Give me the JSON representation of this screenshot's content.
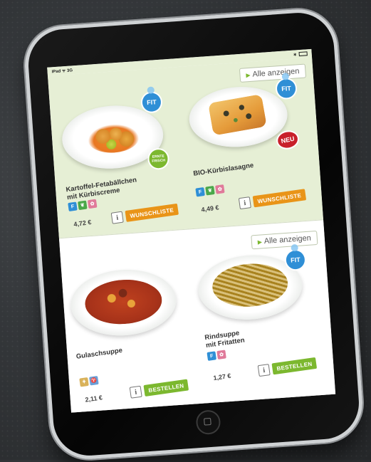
{
  "status_bar": {
    "left": "iPad ᯤ 3G",
    "right": "∗"
  },
  "sections": [
    {
      "show_all_label": "Alle anzeigen",
      "products": [
        {
          "name_line1": "Kartoffel-Fetabällchen",
          "name_line2": "mit Kürbiscreme",
          "price": "4,72 €",
          "badge_fit": "FIT",
          "badge_extra": "ERNTE FRISCH",
          "button_label": "WUNSCHLISTE"
        },
        {
          "name_line1": "BIO-Kürbislasagne",
          "name_line2": "",
          "price": "4,49 €",
          "badge_fit": "FIT",
          "badge_extra": "NEU",
          "button_label": "WUNSCHLISTE"
        }
      ]
    },
    {
      "show_all_label": "Alle anzeigen",
      "products": [
        {
          "name_line1": "Gulaschsuppe",
          "name_line2": "",
          "price": "2,11 €",
          "button_label": "BESTELLEN"
        },
        {
          "name_line1": "Rindsuppe",
          "name_line2": "mit Fritatten",
          "price": "1,27 €",
          "badge_fit": "FIT",
          "button_label": "BESTELLEN"
        }
      ]
    }
  ],
  "info_label": "i",
  "icon_names": [
    "fit-icon",
    "leaf-icon",
    "flower-icon",
    "wheat-icon",
    "sheep-icon"
  ],
  "colors": {
    "accent_green": "#7cb82f",
    "wishlist_orange": "#e99418",
    "fit_blue": "#2f8fd6",
    "neu_red": "#c8202a",
    "section_bg": "#e6efd5"
  }
}
